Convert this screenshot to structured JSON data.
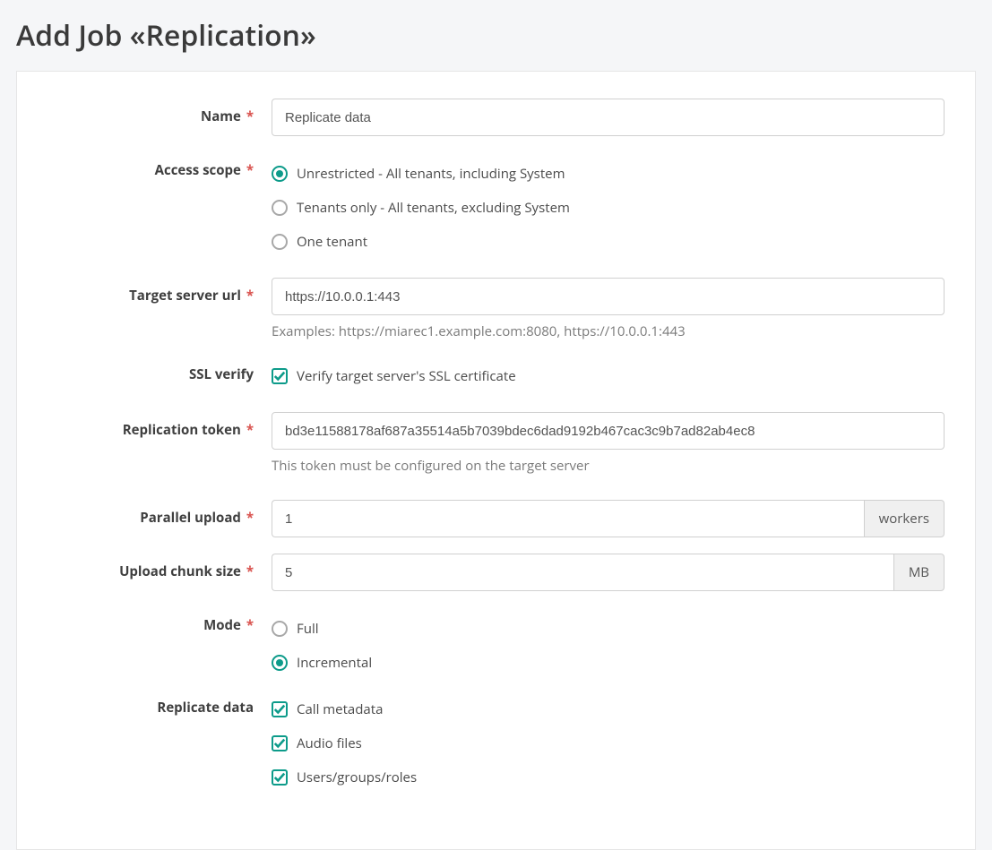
{
  "page_title": "Add Job «Replication»",
  "labels": {
    "name": "Name",
    "access_scope": "Access scope",
    "target_server_url": "Target server url",
    "ssl_verify": "SSL verify",
    "replication_token": "Replication token",
    "parallel_upload": "Parallel upload",
    "upload_chunk_size": "Upload chunk size",
    "mode": "Mode",
    "replicate_data": "Replicate data"
  },
  "required_mark": "*",
  "fields": {
    "name": {
      "value": "Replicate data"
    },
    "access_scope": {
      "options": [
        {
          "id": "unrestricted",
          "label": "Unrestricted - All tenants, including System",
          "selected": true
        },
        {
          "id": "tenants-only",
          "label": "Tenants only - All tenants, excluding System",
          "selected": false
        },
        {
          "id": "one-tenant",
          "label": "One tenant",
          "selected": false
        }
      ]
    },
    "target_server_url": {
      "value": "https://10.0.0.1:443",
      "help": "Examples: https://miarec1.example.com:8080, https://10.0.0.1:443"
    },
    "ssl_verify": {
      "checked": true,
      "label": "Verify target server's SSL certificate"
    },
    "replication_token": {
      "value": "bd3e11588178af687a35514a5b7039bdec6dad9192b467cac3c9b7ad82ab4ec8",
      "help": "This token must be configured on the target server"
    },
    "parallel_upload": {
      "value": "1",
      "unit": "workers"
    },
    "upload_chunk_size": {
      "value": "5",
      "unit": "MB"
    },
    "mode": {
      "options": [
        {
          "id": "full",
          "label": "Full",
          "selected": false
        },
        {
          "id": "incremental",
          "label": "Incremental",
          "selected": true
        }
      ]
    },
    "replicate_data": {
      "options": [
        {
          "id": "call-metadata",
          "label": "Call metadata",
          "checked": true
        },
        {
          "id": "audio-files",
          "label": "Audio files",
          "checked": true
        },
        {
          "id": "users-groups-roles",
          "label": "Users/groups/roles",
          "checked": true
        }
      ]
    }
  }
}
